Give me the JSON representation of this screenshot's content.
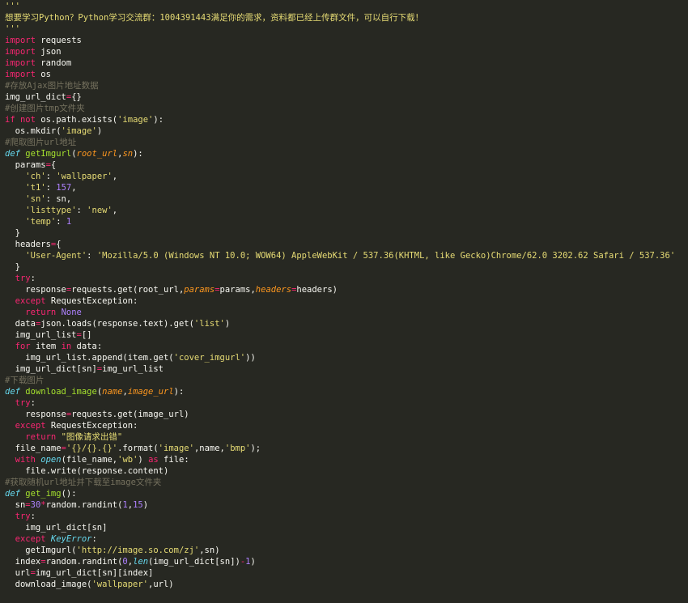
{
  "editor": {
    "lines": [
      [
        [
          "str",
          "'''"
        ]
      ],
      [
        [
          "str",
          "想要学习Python？Python学习交流群：1004391443满足你的需求，资料都已经上传群文件，可以自行下载！"
        ]
      ],
      [
        [
          "str",
          "'''"
        ]
      ],
      [
        [
          "kw",
          "import"
        ],
        [
          "plain",
          " requests"
        ]
      ],
      [
        [
          "kw",
          "import"
        ],
        [
          "plain",
          " json"
        ]
      ],
      [
        [
          "kw",
          "import"
        ],
        [
          "plain",
          " random"
        ]
      ],
      [
        [
          "kw",
          "import"
        ],
        [
          "plain",
          " os"
        ]
      ],
      [
        [
          "cm",
          "#存放Ajax图片地址数据"
        ]
      ],
      [
        [
          "plain",
          "img_url_dict"
        ],
        [
          "op",
          "="
        ],
        [
          "plain",
          "{}"
        ]
      ],
      [
        [
          "cm",
          "#创建图片tmp文件夹"
        ]
      ],
      [
        [
          "kw",
          "if"
        ],
        [
          "plain",
          " "
        ],
        [
          "kw",
          "not"
        ],
        [
          "plain",
          " os.path.exists("
        ],
        [
          "str",
          "'image'"
        ],
        [
          "plain",
          "):"
        ]
      ],
      [
        [
          "plain",
          "  os.mkdir("
        ],
        [
          "str",
          "'image'"
        ],
        [
          "plain",
          ")"
        ]
      ],
      [
        [
          "cm",
          "#爬取图片url地址"
        ]
      ],
      [
        [
          "def",
          "def"
        ],
        [
          "plain",
          " "
        ],
        [
          "fn",
          "getImgurl"
        ],
        [
          "plain",
          "("
        ],
        [
          "param",
          "root_url"
        ],
        [
          "plain",
          ","
        ],
        [
          "param",
          "sn"
        ],
        [
          "plain",
          "):"
        ]
      ],
      [
        [
          "plain",
          "  params"
        ],
        [
          "op",
          "="
        ],
        [
          "plain",
          "{"
        ]
      ],
      [
        [
          "plain",
          "    "
        ],
        [
          "str",
          "'ch'"
        ],
        [
          "plain",
          ": "
        ],
        [
          "str",
          "'wallpaper'"
        ],
        [
          "plain",
          ","
        ]
      ],
      [
        [
          "plain",
          "    "
        ],
        [
          "str",
          "'t1'"
        ],
        [
          "plain",
          ": "
        ],
        [
          "num",
          "157"
        ],
        [
          "plain",
          ","
        ]
      ],
      [
        [
          "plain",
          "    "
        ],
        [
          "str",
          "'sn'"
        ],
        [
          "plain",
          ": sn,"
        ]
      ],
      [
        [
          "plain",
          "    "
        ],
        [
          "str",
          "'listtype'"
        ],
        [
          "plain",
          ": "
        ],
        [
          "str",
          "'new'"
        ],
        [
          "plain",
          ","
        ]
      ],
      [
        [
          "plain",
          "    "
        ],
        [
          "str",
          "'temp'"
        ],
        [
          "plain",
          ": "
        ],
        [
          "num",
          "1"
        ]
      ],
      [
        [
          "plain",
          "  }"
        ]
      ],
      [
        [
          "plain",
          "  headers"
        ],
        [
          "op",
          "="
        ],
        [
          "plain",
          "{"
        ]
      ],
      [
        [
          "plain",
          "    "
        ],
        [
          "str",
          "'User-Agent'"
        ],
        [
          "plain",
          ": "
        ],
        [
          "str",
          "'Mozilla/5.0 (Windows NT 10.0; WOW64) AppleWebKit / 537.36(KHTML, like Gecko)Chrome/62.0 3202.62 Safari / 537.36'"
        ]
      ],
      [
        [
          "plain",
          "  }"
        ]
      ],
      [
        [
          "plain",
          "  "
        ],
        [
          "kw",
          "try"
        ],
        [
          "plain",
          ":"
        ]
      ],
      [
        [
          "plain",
          "    response"
        ],
        [
          "op",
          "="
        ],
        [
          "plain",
          "requests.get(root_url,"
        ],
        [
          "param",
          "params"
        ],
        [
          "op",
          "="
        ],
        [
          "plain",
          "params,"
        ],
        [
          "param",
          "headers"
        ],
        [
          "op",
          "="
        ],
        [
          "plain",
          "headers)"
        ]
      ],
      [
        [
          "plain",
          "  "
        ],
        [
          "kw",
          "except"
        ],
        [
          "plain",
          " RequestException:"
        ]
      ],
      [
        [
          "plain",
          "    "
        ],
        [
          "kw",
          "return"
        ],
        [
          "plain",
          " "
        ],
        [
          "const",
          "None"
        ]
      ],
      [
        [
          "plain",
          "  data"
        ],
        [
          "op",
          "="
        ],
        [
          "plain",
          "json.loads(response.text).get("
        ],
        [
          "str",
          "'list'"
        ],
        [
          "plain",
          ")"
        ]
      ],
      [
        [
          "plain",
          "  img_url_list"
        ],
        [
          "op",
          "="
        ],
        [
          "plain",
          "[]"
        ]
      ],
      [
        [
          "plain",
          "  "
        ],
        [
          "kw",
          "for"
        ],
        [
          "plain",
          " item "
        ],
        [
          "kw",
          "in"
        ],
        [
          "plain",
          " data:"
        ]
      ],
      [
        [
          "plain",
          "    img_url_list.append(item.get("
        ],
        [
          "str",
          "'cover_imgurl'"
        ],
        [
          "plain",
          "))"
        ]
      ],
      [
        [
          "plain",
          "  img_url_dict[sn]"
        ],
        [
          "op",
          "="
        ],
        [
          "plain",
          "img_url_list"
        ]
      ],
      [
        [
          "cm",
          "#下载图片"
        ]
      ],
      [
        [
          "def",
          "def"
        ],
        [
          "plain",
          " "
        ],
        [
          "fn",
          "download_image"
        ],
        [
          "plain",
          "("
        ],
        [
          "param",
          "name"
        ],
        [
          "plain",
          ","
        ],
        [
          "param",
          "image_url"
        ],
        [
          "plain",
          "):"
        ]
      ],
      [
        [
          "plain",
          "  "
        ],
        [
          "kw",
          "try"
        ],
        [
          "plain",
          ":"
        ]
      ],
      [
        [
          "plain",
          "    response"
        ],
        [
          "op",
          "="
        ],
        [
          "plain",
          "requests.get(image_url)"
        ]
      ],
      [
        [
          "plain",
          "  "
        ],
        [
          "kw",
          "except"
        ],
        [
          "plain",
          " RequestException:"
        ]
      ],
      [
        [
          "plain",
          "    "
        ],
        [
          "kw",
          "return"
        ],
        [
          "plain",
          " "
        ],
        [
          "str",
          "\"图像请求出错\""
        ]
      ],
      [
        [
          "plain",
          "  file_name"
        ],
        [
          "op",
          "="
        ],
        [
          "str",
          "'{}/{}.{}'"
        ],
        [
          "plain",
          ".format("
        ],
        [
          "str",
          "'image'"
        ],
        [
          "plain",
          ",name,"
        ],
        [
          "str",
          "'bmp'"
        ],
        [
          "plain",
          ");"
        ]
      ],
      [
        [
          "plain",
          "  "
        ],
        [
          "kw",
          "with"
        ],
        [
          "plain",
          " "
        ],
        [
          "bi",
          "open"
        ],
        [
          "plain",
          "(file_name,"
        ],
        [
          "str",
          "'wb'"
        ],
        [
          "plain",
          ") "
        ],
        [
          "kw",
          "as"
        ],
        [
          "plain",
          " file:"
        ]
      ],
      [
        [
          "plain",
          "    file.write(response.content)"
        ]
      ],
      [
        [
          "cm",
          "#获取随机url地址并下载至image文件夹"
        ]
      ],
      [
        [
          "def",
          "def"
        ],
        [
          "plain",
          " "
        ],
        [
          "fn",
          "get_img"
        ],
        [
          "plain",
          "():"
        ]
      ],
      [
        [
          "plain",
          "  sn"
        ],
        [
          "op",
          "="
        ],
        [
          "num",
          "30"
        ],
        [
          "op",
          "*"
        ],
        [
          "plain",
          "random.randint("
        ],
        [
          "num",
          "1"
        ],
        [
          "plain",
          ","
        ],
        [
          "num",
          "15"
        ],
        [
          "plain",
          ")"
        ]
      ],
      [
        [
          "plain",
          "  "
        ],
        [
          "kw",
          "try"
        ],
        [
          "plain",
          ":"
        ]
      ],
      [
        [
          "plain",
          "    img_url_dict[sn]"
        ]
      ],
      [
        [
          "plain",
          "  "
        ],
        [
          "kw",
          "except"
        ],
        [
          "plain",
          " "
        ],
        [
          "bi",
          "KeyError"
        ],
        [
          "plain",
          ":"
        ]
      ],
      [
        [
          "plain",
          "    getImgurl("
        ],
        [
          "str",
          "'http://image.so.com/zj'"
        ],
        [
          "plain",
          ",sn)"
        ]
      ],
      [
        [
          "plain",
          "  index"
        ],
        [
          "op",
          "="
        ],
        [
          "plain",
          "random.randint("
        ],
        [
          "num",
          "0"
        ],
        [
          "plain",
          ","
        ],
        [
          "bi",
          "len"
        ],
        [
          "plain",
          "(img_url_dict[sn])"
        ],
        [
          "op",
          "-"
        ],
        [
          "num",
          "1"
        ],
        [
          "plain",
          ")"
        ]
      ],
      [
        [
          "plain",
          "  url"
        ],
        [
          "op",
          "="
        ],
        [
          "plain",
          "img_url_dict[sn][index]"
        ]
      ],
      [
        [
          "plain",
          "  download_image("
        ],
        [
          "str",
          "'wallpaper'"
        ],
        [
          "plain",
          ",url)"
        ]
      ]
    ]
  }
}
